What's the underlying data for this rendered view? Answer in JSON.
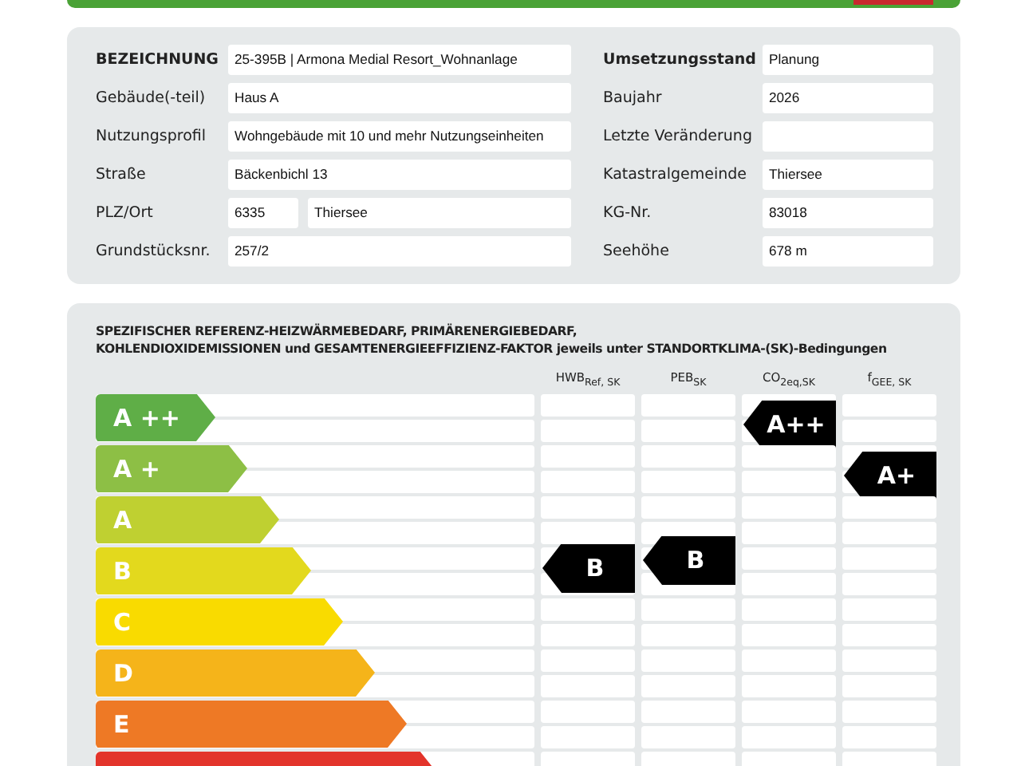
{
  "info": {
    "left": [
      {
        "label": "BEZEICHNUNG",
        "values": [
          "25-395B | Armona Medial Resort_Wohnanlage"
        ]
      },
      {
        "label": "Gebäude(-teil)",
        "values": [
          "Haus A"
        ]
      },
      {
        "label": "Nutzungsprofil",
        "values": [
          "Wohngebäude mit 10 und mehr Nutzungseinheiten"
        ]
      },
      {
        "label": "Straße",
        "values": [
          "Bäckenbichl  13"
        ]
      },
      {
        "label": "PLZ/Ort",
        "values": [
          "6335",
          "Thiersee"
        ]
      },
      {
        "label": "Grundstücksnr.",
        "values": [
          "257/2"
        ]
      }
    ],
    "right": [
      {
        "label": "Umsetzungsstand",
        "value": "Planung"
      },
      {
        "label": "Baujahr",
        "value": "2026"
      },
      {
        "label": "Letzte Veränderung"
      },
      {
        "label": "Katastralgemeinde",
        "value": "Thiersee"
      },
      {
        "label": "KG-Nr.",
        "value": "83018"
      },
      {
        "label": "Seehöhe",
        "value": "678 m"
      }
    ]
  },
  "energy": {
    "heading": [
      "SPEZIFISCHER REFERENZ-HEIZWÄRMEBEDARF, PRIMÄRENERGIEBEDARF,",
      "KOHLENDIOXIDEMISSIONEN und GESAMTENERGIEEFFIZIENZ-FAKTOR jeweils unter STANDORTKLIMA-(SK)-Bedingungen"
    ],
    "columns": [
      "HWB$_{Ref, SK}$",
      "PEB$_{SK}$",
      "CO$_{2eq,SK}$",
      "f$_{GEE, SK}$"
    ],
    "classes": [
      {
        "label": "A ++",
        "color": "#5fae47",
        "cells": [
          {
            "marked": false
          },
          {
            "marked": false
          },
          {
            "marked": true,
            "rating": "A++"
          },
          {
            "marked": false
          }
        ]
      },
      {
        "label": "A +",
        "color": "#8dbf45",
        "cells": [
          {
            "marked": false
          },
          {
            "marked": false
          },
          {
            "marked": false
          },
          {
            "marked": true,
            "rating": "A+"
          }
        ]
      },
      {
        "label": "A",
        "color": "#bfd031",
        "cells": [
          {
            "marked": false
          },
          {
            "marked": false
          },
          {
            "marked": false
          },
          {
            "marked": false
          }
        ]
      },
      {
        "label": "B",
        "color": "#e3d91d",
        "cells": [
          {
            "marked": true,
            "rating": "B"
          },
          {
            "marked": true,
            "rating": "B"
          },
          {
            "marked": false
          },
          {
            "marked": false
          }
        ]
      },
      {
        "label": "C",
        "color": "#f9db00",
        "cells": [
          {
            "marked": false
          },
          {
            "marked": false
          },
          {
            "marked": false
          },
          {
            "marked": false
          }
        ]
      },
      {
        "label": "D",
        "color": "#f5b41a",
        "cells": [
          {
            "marked": false
          },
          {
            "marked": false
          },
          {
            "marked": false
          },
          {
            "marked": false
          }
        ]
      },
      {
        "label": "E",
        "color": "#ee7925",
        "cells": [
          {
            "marked": false
          },
          {
            "marked": false
          },
          {
            "marked": false
          },
          {
            "marked": false
          }
        ]
      },
      {
        "color": "#e3342b",
        "cells": [
          {
            "marked": false
          },
          {
            "marked": false
          },
          {
            "marked": false
          },
          {
            "marked": false
          }
        ]
      }
    ]
  }
}
